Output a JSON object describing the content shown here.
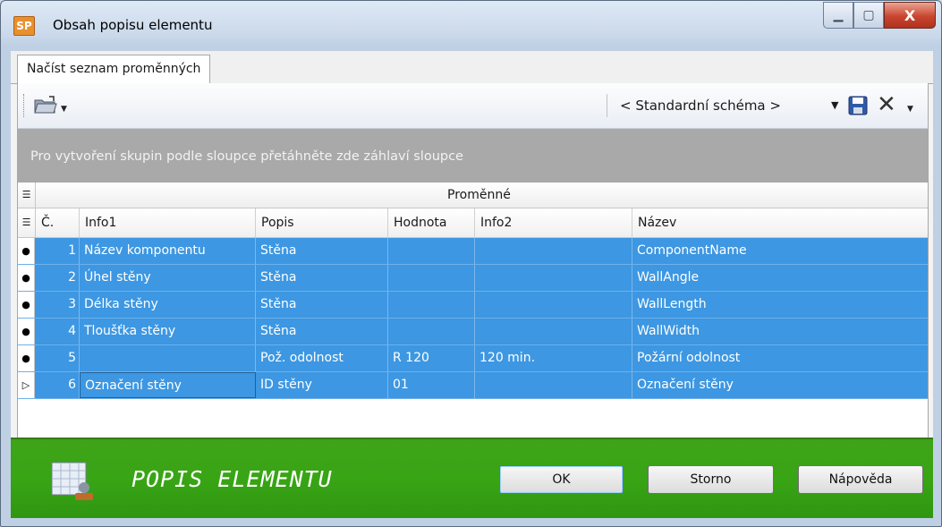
{
  "window": {
    "title": "Obsah popisu elementu",
    "app_badge": "SP"
  },
  "tabs": [
    {
      "label": "Načíst seznam proměnných"
    }
  ],
  "toolbar": {
    "schema_value": "< Standardní schéma >"
  },
  "grid": {
    "group_hint": "Pro vytvoření skupin podle sloupce přetáhněte zde záhlaví sloupce",
    "band_caption": "Proměnné",
    "columns": [
      "Č.",
      "Info1",
      "Popis",
      "Hodnota",
      "Info2",
      "Název"
    ],
    "rows": [
      {
        "num": "1",
        "info1": "Název komponentu",
        "popis": "Stěna",
        "hodnota": "",
        "info2": "",
        "nazev": "ComponentName"
      },
      {
        "num": "2",
        "info1": "Úhel stěny",
        "popis": "Stěna",
        "hodnota": "",
        "info2": "",
        "nazev": "WallAngle"
      },
      {
        "num": "3",
        "info1": "Délka stěny",
        "popis": "Stěna",
        "hodnota": "",
        "info2": "",
        "nazev": "WallLength"
      },
      {
        "num": "4",
        "info1": "Tloušťka stěny",
        "popis": "Stěna",
        "hodnota": "",
        "info2": "",
        "nazev": "WallWidth"
      },
      {
        "num": "5",
        "info1": "",
        "popis": "Pož. odolnost",
        "hodnota": "R 120",
        "info2": "120 min.",
        "nazev": "Požární odolnost"
      },
      {
        "num": "6",
        "info1": "Označení stěny",
        "popis": "ID stěny",
        "hodnota": "01",
        "info2": "",
        "nazev": "Označení stěny"
      }
    ]
  },
  "footer": {
    "title": "POPIS ELEMENTU",
    "ok_label": "OK",
    "cancel_label": "Storno",
    "help_label": "Nápověda"
  },
  "colors": {
    "selection": "#3d97e2",
    "footer_green": "#38a515",
    "group_gray": "#a9a9a9"
  }
}
